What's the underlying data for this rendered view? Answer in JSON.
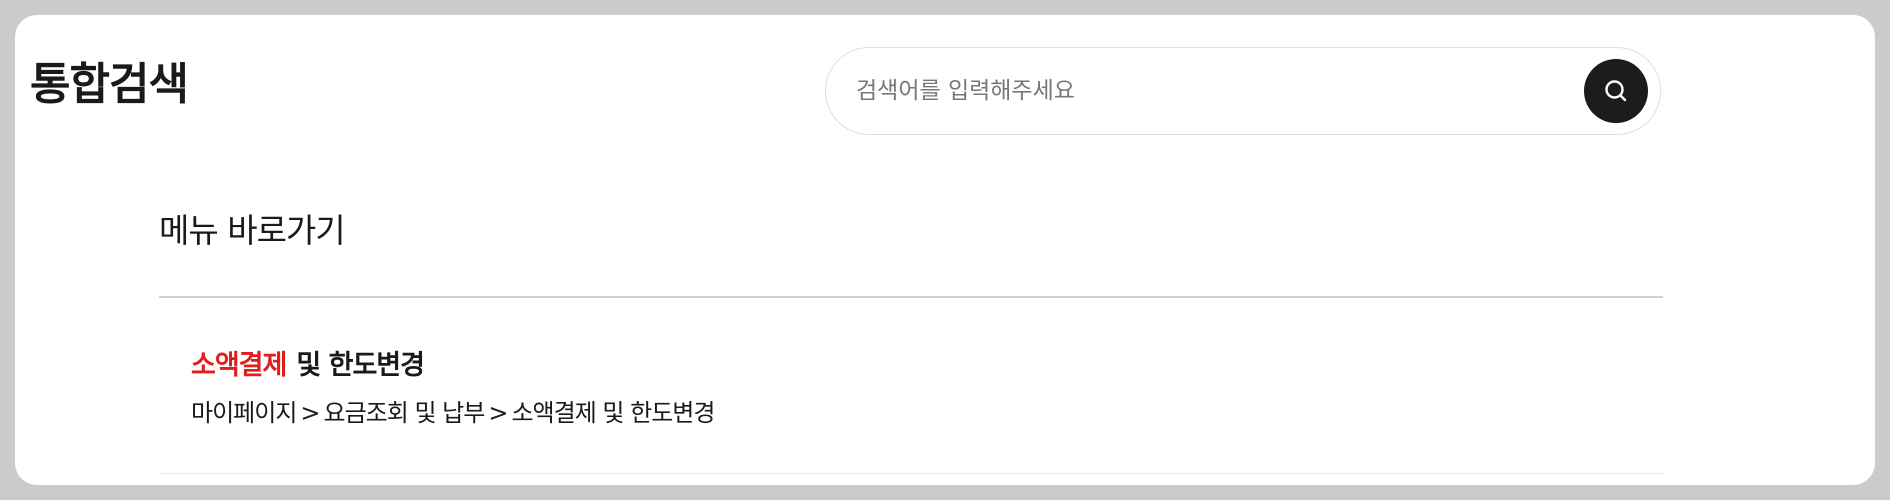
{
  "header": {
    "title": "통합검색"
  },
  "search": {
    "placeholder": "검색어를 입력해주세요",
    "value": "",
    "button_icon": "search-icon"
  },
  "menu_section": {
    "title": "메뉴 바로가기",
    "results": [
      {
        "title_highlight": "소액결제",
        "title_rest": "및 한도변경",
        "path": [
          "마이페이지",
          "요금조회 및 납부",
          "소액결제 및 한도변경"
        ],
        "separator": ">"
      }
    ]
  },
  "colors": {
    "highlight": "#e01e1e",
    "search_button_bg": "#1c1c1c",
    "page_background": "#cbcbcb",
    "card_background": "#ffffff"
  }
}
